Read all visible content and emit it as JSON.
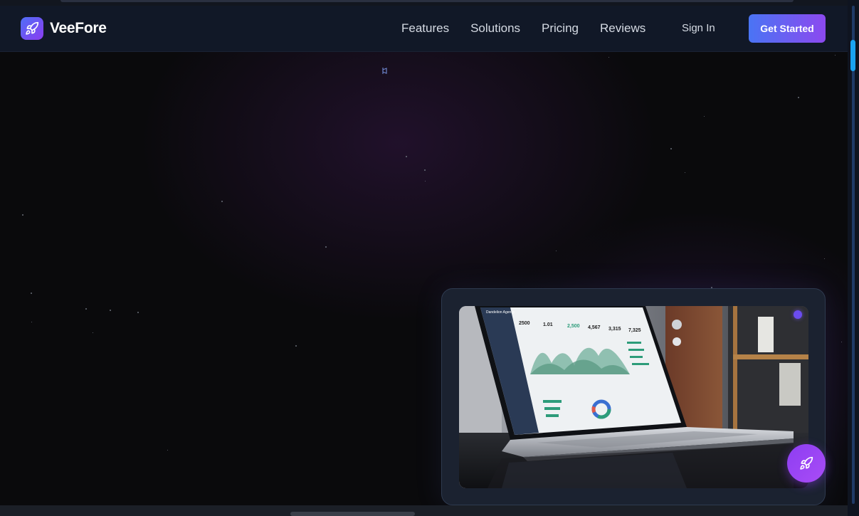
{
  "brand": {
    "name": "VeeFore",
    "logo_icon": "rocket-icon"
  },
  "nav": {
    "links": [
      {
        "label": "Features"
      },
      {
        "label": "Solutions"
      },
      {
        "label": "Pricing"
      },
      {
        "label": "Reviews"
      }
    ],
    "sign_in_label": "Sign In",
    "cta_label": "Get Started"
  },
  "hero_media": {
    "image": "laptop-analytics-dashboard-photo",
    "dashboard_title": "Dandelion Agency",
    "stats": [
      "2500",
      "1.01",
      "2,500",
      "4,567",
      "3,315",
      "7,325"
    ]
  },
  "fab": {
    "icon": "rocket-icon"
  },
  "colors": {
    "page_background": "#0a0a0c",
    "navbar_background": "#111827",
    "cta_gradient_start": "#4a74f4",
    "cta_gradient_end": "#8c49ef",
    "fab_color": "#9b45f4",
    "scroll_thumb": "#1aa3f0"
  }
}
